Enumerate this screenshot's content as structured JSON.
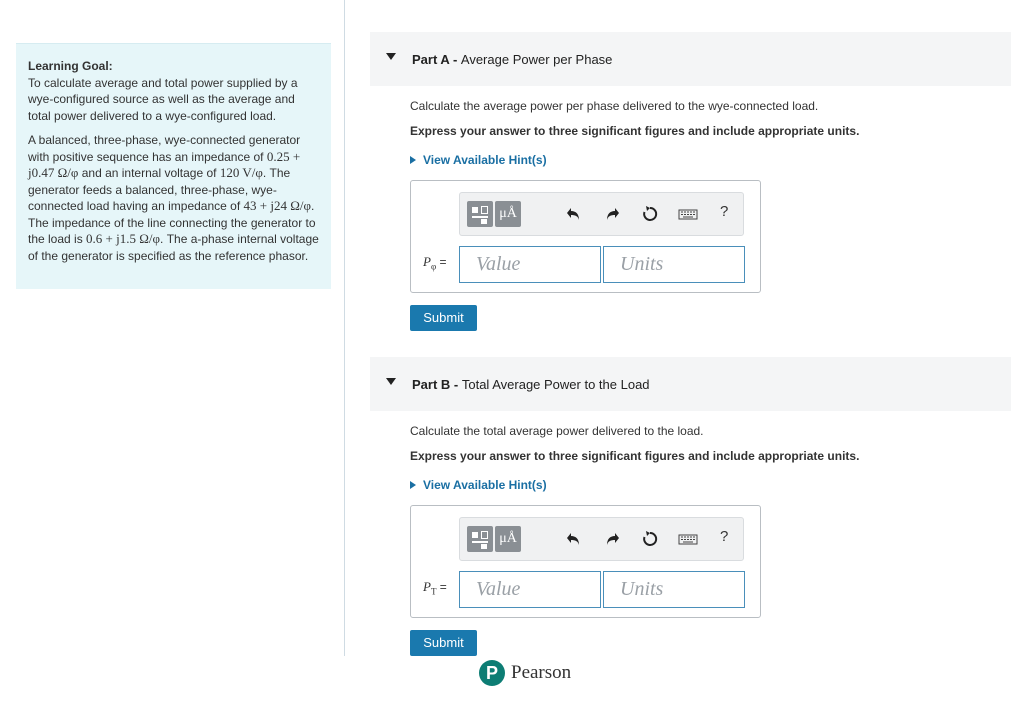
{
  "goal": {
    "title": "Learning Goal:",
    "intro": "To calculate average and total power supplied by a wye-configured source as well as the average and total power delivered to a wye-configured load.",
    "p2_a": "A balanced, three-phase, wye-connected generator with positive sequence has an impedance of ",
    "p2_m1": "0.25 + j0.47 Ω/φ",
    "p2_b": " and an internal voltage of ",
    "p2_m2": "120 V/φ",
    "p2_c": ". The generator feeds a balanced, three-phase, wye-connected load having an impedance of ",
    "p2_m3": "43 + j24 Ω/φ",
    "p2_d": ". The impedance of the line connecting the generator to the load is ",
    "p2_m4": "0.6 + j1.5 Ω/φ",
    "p2_e": ". The a-phase internal voltage of the generator is specified as the reference phasor."
  },
  "parts": [
    {
      "label": "Part A",
      "sep": " - ",
      "title": "Average Power per Phase",
      "instruction": "Calculate the average power per phase delivered to the wye-connected load.",
      "bold_instruction": "Express your answer to three significant figures and include appropriate units.",
      "hint": "View Available Hint(s)",
      "var": "P",
      "sub": "φ",
      "eq": " =",
      "value_placeholder": "Value",
      "units_placeholder": "Units",
      "submit": "Submit"
    },
    {
      "label": "Part B",
      "sep": " - ",
      "title": "Total Average Power to the Load",
      "instruction": "Calculate the total average power delivered to the load.",
      "bold_instruction": "Express your answer to three significant figures and include appropriate units.",
      "hint": "View Available Hint(s)",
      "var": "P",
      "sub": "T",
      "eq": " =",
      "value_placeholder": "Value",
      "units_placeholder": "Units",
      "submit": "Submit"
    }
  ],
  "toolbar": {
    "units_btn": "μÅ",
    "help": "?",
    "icons": [
      "templates-icon",
      "units-icon",
      "undo-icon",
      "redo-icon",
      "reset-icon",
      "keyboard-icon",
      "help-icon"
    ]
  },
  "footer": {
    "logo_letter": "P",
    "brand": "Pearson"
  },
  "colors": {
    "accent": "#1a79ae",
    "link": "#1a6fa3",
    "goal_bg": "#e6f6f9",
    "brand": "#0d7d74"
  }
}
